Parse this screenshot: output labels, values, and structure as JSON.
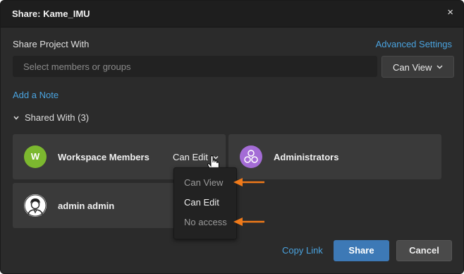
{
  "dialog": {
    "title": "Share: Kame_IMU",
    "close_label": "×"
  },
  "share": {
    "label": "Share Project With",
    "advanced_settings": "Advanced Settings",
    "search_placeholder": "Select members or groups",
    "permission_button": "Can View",
    "add_note": "Add a Note"
  },
  "shared_with": {
    "header": "Shared With (3)",
    "members": [
      {
        "name": "Workspace Members",
        "avatar_letter": "W",
        "avatar_color": "#7cb82f",
        "permission": "Can Edit"
      },
      {
        "name": "Administrators",
        "avatar_icon": "group-icon",
        "avatar_color": "#a46cd6"
      },
      {
        "name": "admin admin",
        "avatar_icon": "user-avatar-icon"
      }
    ]
  },
  "permission_menu": {
    "items": [
      {
        "label": "Can View",
        "color": "#9a9a9a"
      },
      {
        "label": "Can Edit",
        "color": "#f0f0f0"
      },
      {
        "label": "No access",
        "color": "#9a9a9a"
      }
    ]
  },
  "footer": {
    "copy_link": "Copy Link",
    "share": "Share",
    "cancel": "Cancel"
  },
  "colors": {
    "accent_link": "#4aa3df",
    "primary_button": "#3d79b6",
    "annotation_arrow": "#f07a1a"
  }
}
